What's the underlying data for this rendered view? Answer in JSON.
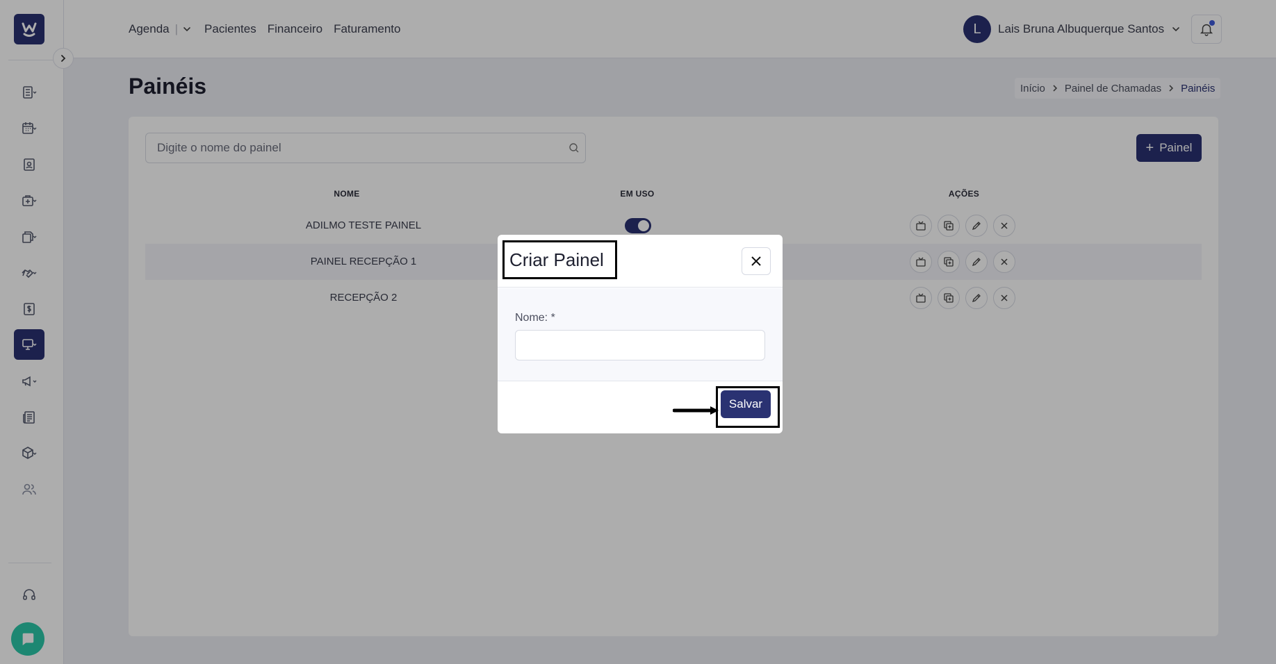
{
  "topnav": {
    "agenda": "Agenda",
    "pacientes": "Pacientes",
    "financeiro": "Financeiro",
    "faturamento": "Faturamento"
  },
  "user": {
    "initial": "L",
    "name": "Lais Bruna Albuquerque Santos"
  },
  "page": {
    "title": "Painéis"
  },
  "breadcrumb": {
    "home": "Início",
    "section": "Painel de Chamadas",
    "current": "Painéis"
  },
  "search": {
    "placeholder": "Digite o nome do painel"
  },
  "add_button": {
    "label": "Painel"
  },
  "table": {
    "headers": {
      "nome": "NOME",
      "em_uso": "EM USO",
      "acoes": "AÇÕES"
    },
    "rows": [
      {
        "nome": "ADILMO TESTE PAINEL",
        "em_uso": true
      },
      {
        "nome": "PAINEL RECEPÇÃO 1",
        "em_uso": true
      },
      {
        "nome": "RECEPÇÃO 2",
        "em_uso": true
      }
    ]
  },
  "modal": {
    "title": "Criar Painel",
    "field_label": "Nome: *",
    "field_value": "",
    "save_label": "Salvar"
  },
  "sidebar": {
    "icons": [
      "clipboard-list-icon",
      "calendar-icon",
      "id-badge-icon",
      "medical-bag-icon",
      "documents-icon",
      "handshake-icon",
      "dollar-icon",
      "monitor-icon",
      "megaphone-icon",
      "newspaper-icon",
      "package-icon",
      "users-icon",
      "headset-icon"
    ],
    "active": "monitor-icon"
  },
  "colors": {
    "primary": "#2a3272",
    "chat": "#2cc7a8",
    "notification_dot": "#3f5bd9"
  }
}
